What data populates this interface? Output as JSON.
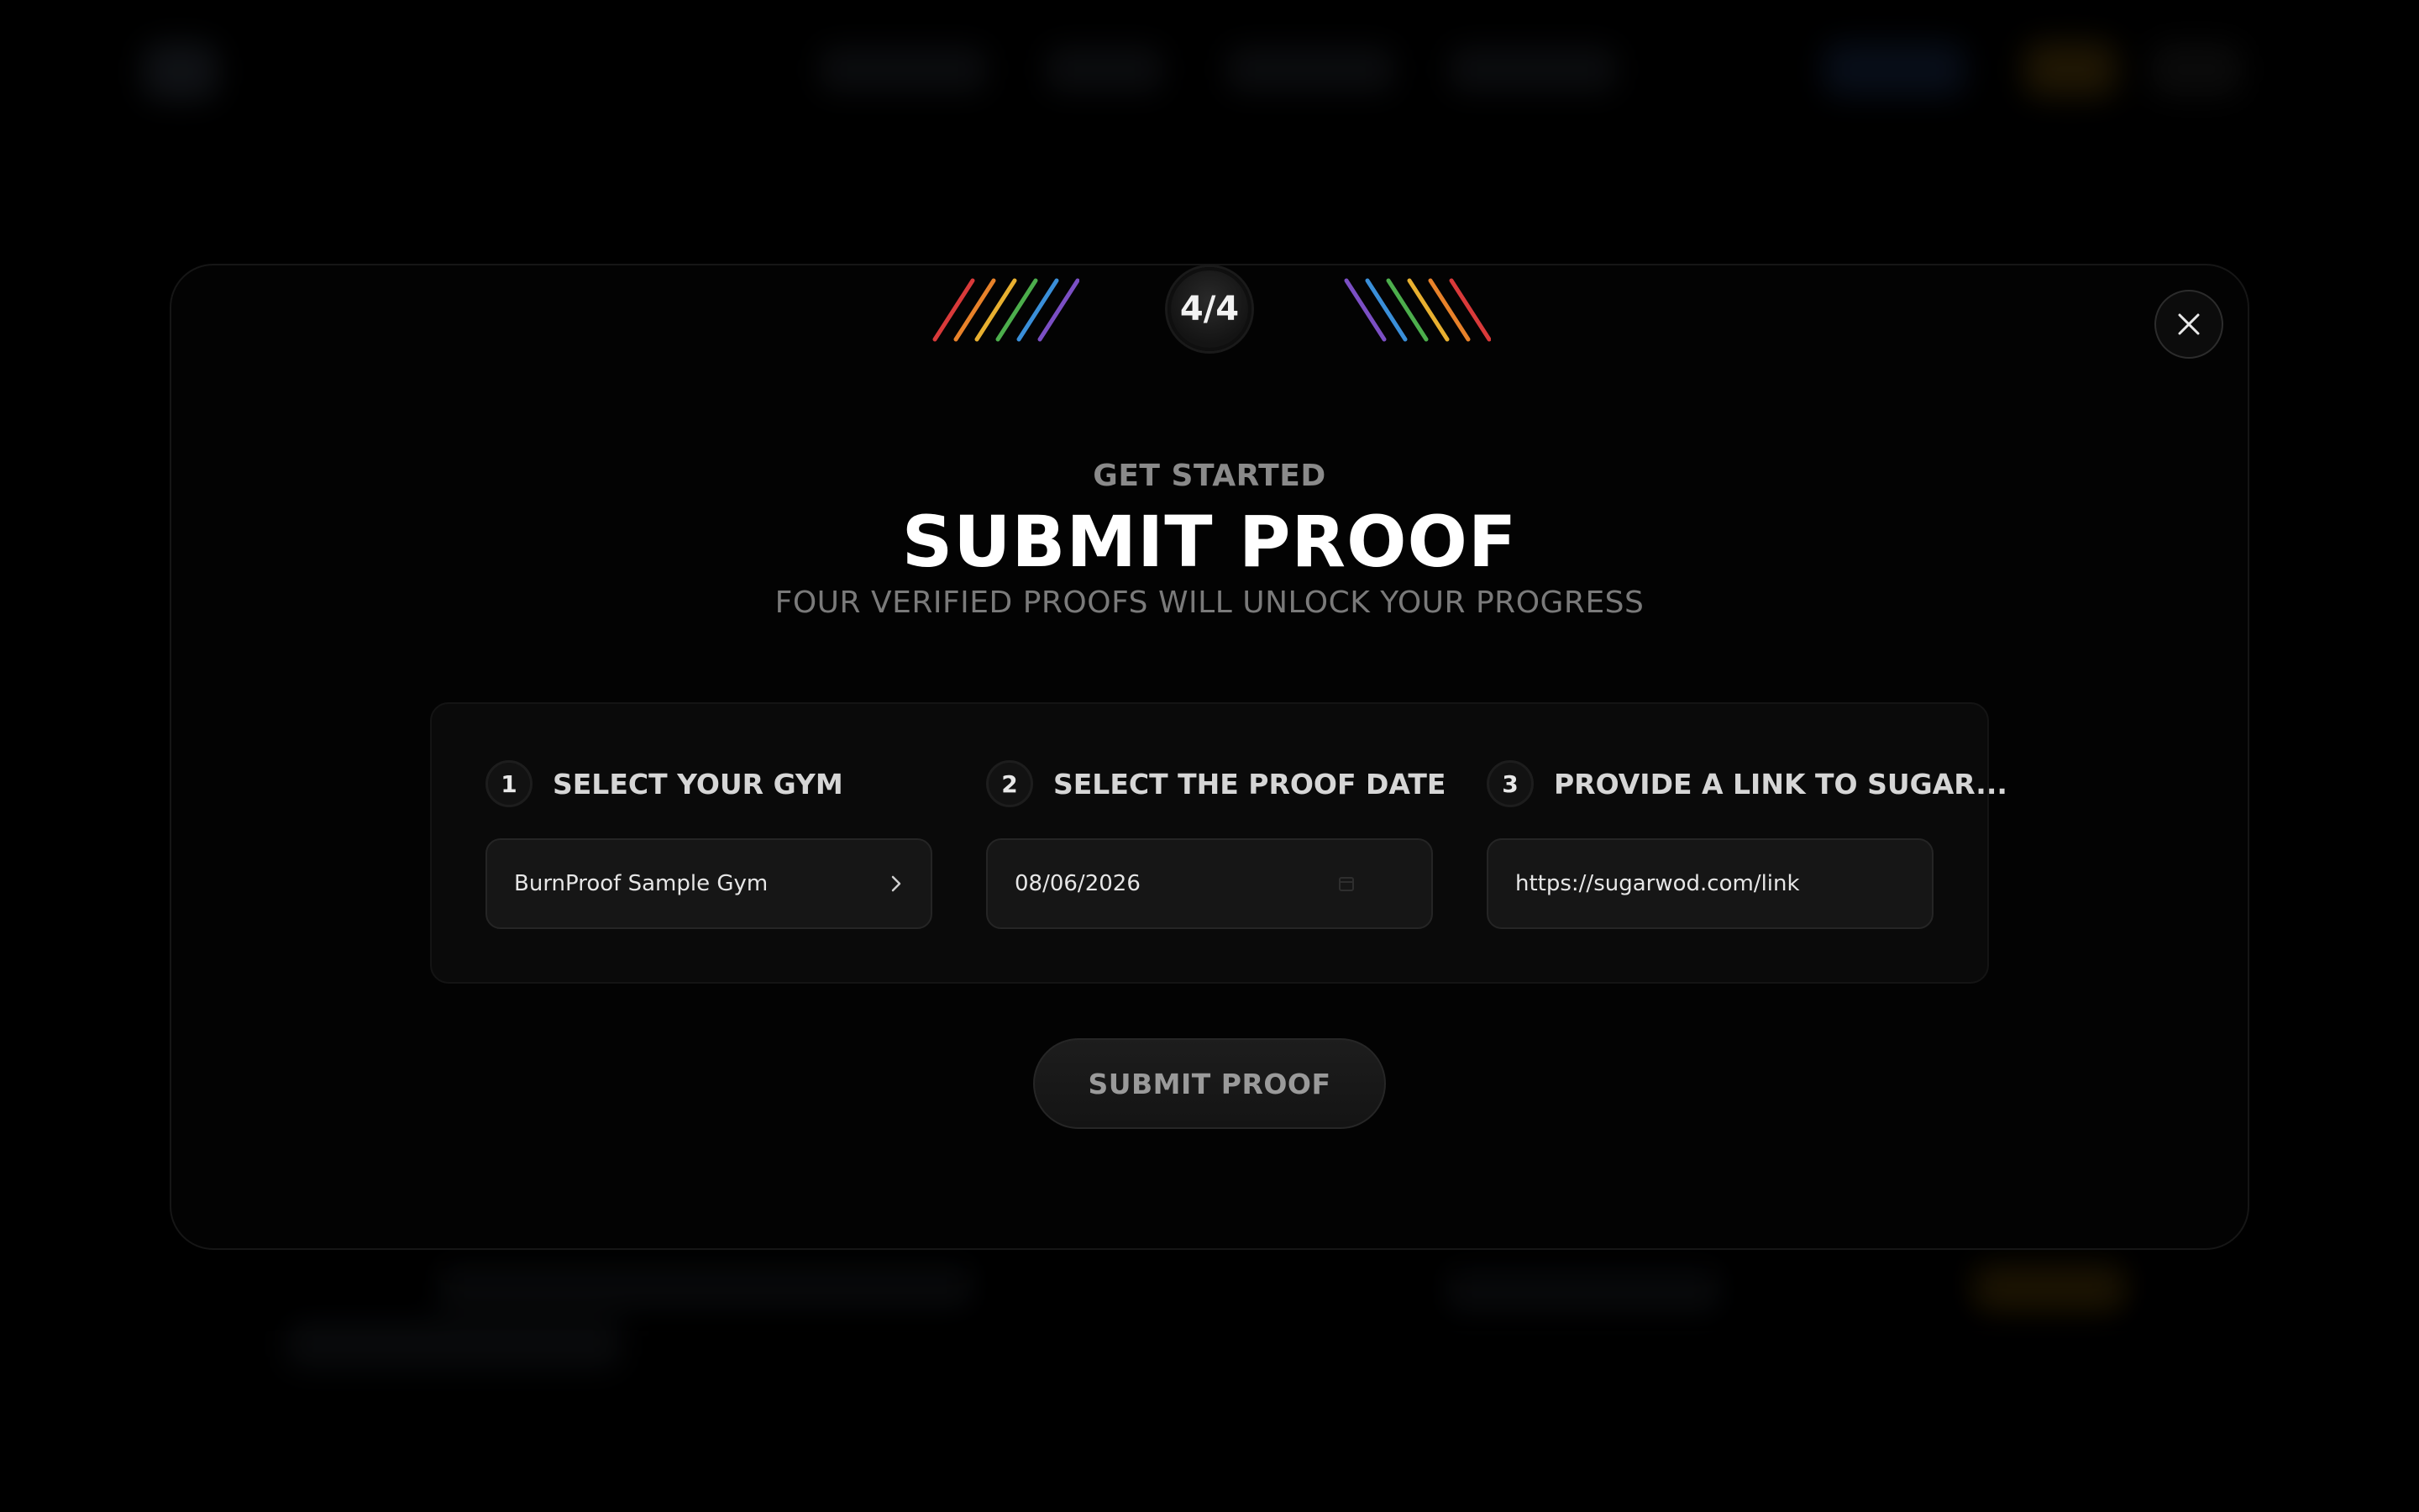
{
  "modal": {
    "step_counter": "4/4",
    "eyebrow": "GET STARTED",
    "title": "SUBMIT PROOF",
    "subtitle": "FOUR VERIFIED PROOFS WILL UNLOCK YOUR PROGRESS",
    "close_icon": "close-icon",
    "stripe_colors": [
      "#d93a3a",
      "#e8822a",
      "#e8b030",
      "#4cae4c",
      "#3a8fd9",
      "#7b4fc4"
    ]
  },
  "form": {
    "gym": {
      "number": "1",
      "label": "SELECT YOUR GYM",
      "value": "BurnProof Sample Gym",
      "icon": "chevron-right-icon"
    },
    "date": {
      "number": "2",
      "label": "SELECT THE PROOF DATE",
      "value": "08/06/2026",
      "icon": "calendar-icon"
    },
    "link": {
      "number": "3",
      "label": "PROVIDE A LINK TO SUGAR...",
      "value": "https://sugarwod.com/link"
    },
    "submit_label": "SUBMIT PROOF"
  }
}
